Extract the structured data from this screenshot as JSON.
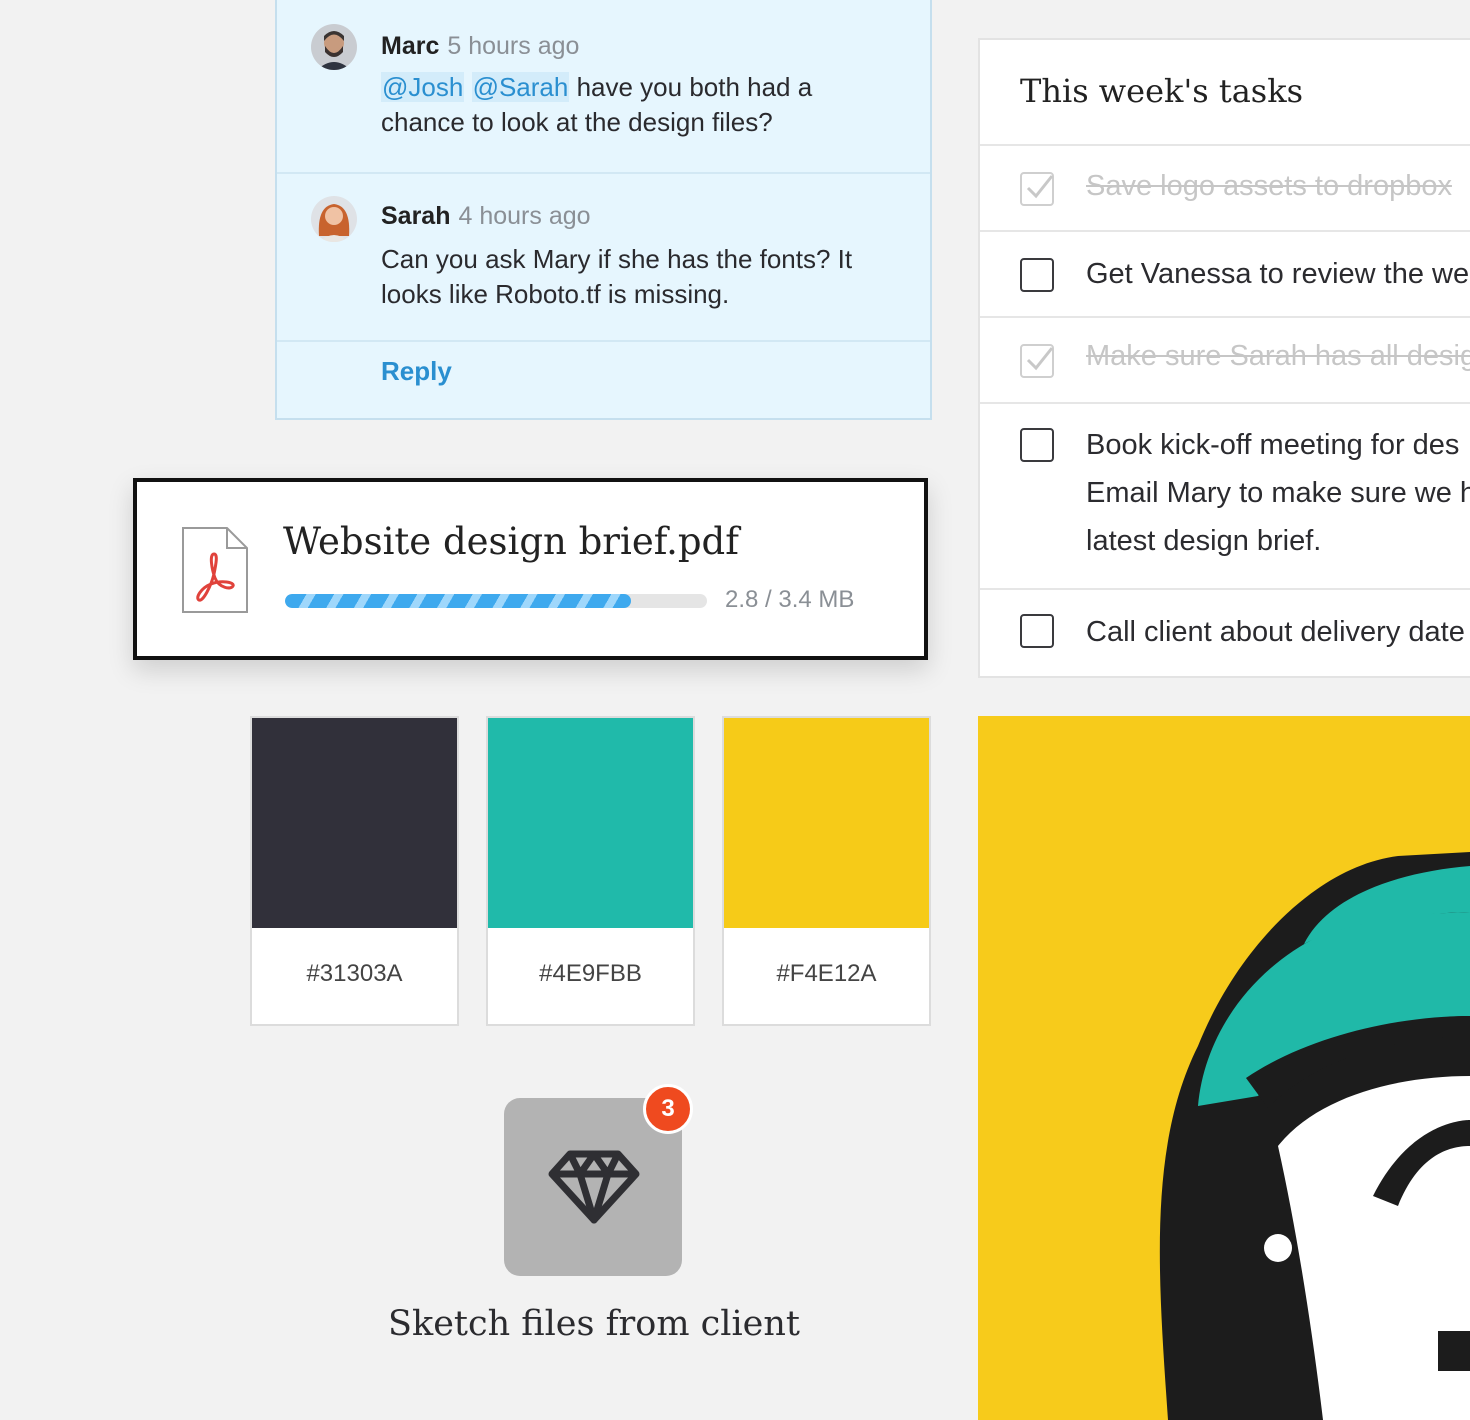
{
  "comments": [
    {
      "author": "Marc",
      "time": "5 hours ago",
      "mention1": "@Josh",
      "mention2": "@Sarah",
      "text_after_mentions": " have you both had a chance to look at the design files?"
    },
    {
      "author": "Sarah",
      "time": "4 hours ago",
      "text": "Can you ask Mary if she has the fonts? It looks like Roboto.tf is missing."
    }
  ],
  "reply_label": "Reply",
  "file_upload": {
    "name": "Website design brief.pdf",
    "size": "2.8 / 3.4 MB",
    "progress_fraction": 0.82,
    "icon": "pdf-file-icon"
  },
  "swatches": [
    {
      "hex": "#31303A",
      "color": "#31303A"
    },
    {
      "hex": "#4E9FBB",
      "color": "#20BAAA"
    },
    {
      "hex": "#F4E12A",
      "color": "#F6CB18"
    }
  ],
  "folder": {
    "label": "Sketch files from client",
    "badge_count": "3",
    "icon": "diamond-icon"
  },
  "tasks_panel": {
    "title": "This week's tasks",
    "items": [
      {
        "text": "Save logo assets to dropbox",
        "done": true
      },
      {
        "text": "Get Vanessa to review the we",
        "done": false
      },
      {
        "text": "Make sure Sarah has all desig",
        "done": true
      },
      {
        "text_line1": "Book kick-off meeting for des",
        "text_line2": "Email Mary to make sure we h",
        "text_line3": "latest design brief.",
        "done": false
      },
      {
        "text": "Call client about delivery date",
        "done": false
      }
    ]
  },
  "colors": {
    "accent_blue": "#2a8fd0",
    "badge_red": "#ef4a1f",
    "illustration_yellow": "#f7cb1b",
    "illustration_teal": "#20b9a8"
  }
}
